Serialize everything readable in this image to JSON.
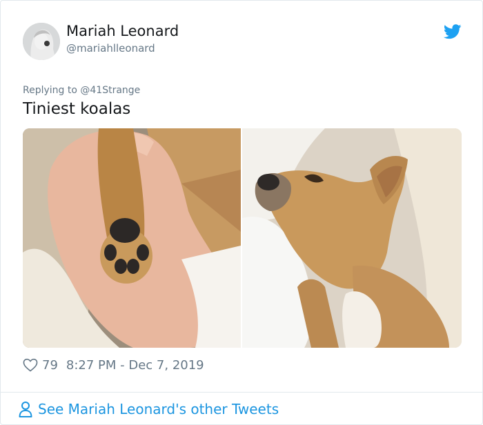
{
  "tweet": {
    "author_name": "Mariah Leonard",
    "author_handle": "@mariahlleonard",
    "replying_to_prefix": "Replying to ",
    "replying_to_handle": "@41Strange",
    "text": "Tiniest koalas",
    "likes": "79",
    "timestamp": "8:27 PM - Dec 7, 2019"
  },
  "footer": {
    "see_more_label": "See Mariah Leonard's other Tweets"
  },
  "icons": {
    "brand": "twitter-bird-icon",
    "like": "heart-icon",
    "profile": "person-icon"
  },
  "colors": {
    "brand_blue": "#1da1f2",
    "link_blue": "#1b95e0",
    "secondary_text": "#657786",
    "border": "#e1e8ed"
  }
}
